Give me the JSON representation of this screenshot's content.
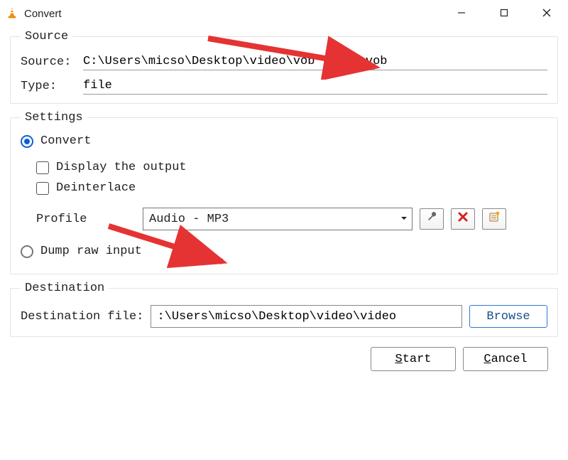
{
  "window": {
    "title": "Convert"
  },
  "source_group": {
    "legend": "Source",
    "source_label": "Source:",
    "source_value": "C:\\Users\\micso\\Desktop\\video\\vob video.vob",
    "type_label": "Type:",
    "type_value": "file"
  },
  "settings_group": {
    "legend": "Settings",
    "convert_label": "Convert",
    "display_output_label": "Display the output",
    "deinterlace_label": "Deinterlace",
    "profile_label": "Profile",
    "profile_value": "Audio - MP3",
    "dump_raw_label": "Dump raw input"
  },
  "destination_group": {
    "legend": "Destination",
    "dest_label": "Destination file:",
    "dest_value": ":\\Users\\micso\\Desktop\\video\\video",
    "browse_label": "Browse"
  },
  "footer": {
    "start_label_pre": "S",
    "start_label_rest": "tart",
    "cancel_label_pre": "C",
    "cancel_label_rest": "ancel"
  }
}
